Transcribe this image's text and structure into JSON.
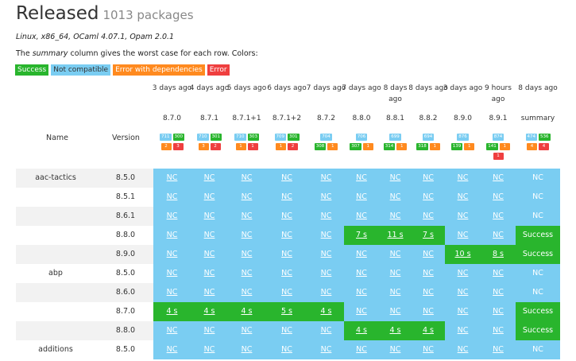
{
  "header": {
    "title": "Released",
    "count": "1013 packages"
  },
  "env": "Linux, x86_64, OCaml 4.07.1, Opam 2.0.1",
  "note": {
    "pre": "The ",
    "em": "summary",
    "post": " column gives the worst case for each row. Colors:"
  },
  "legend": [
    "Success",
    "Not compatible",
    "Error with dependencies",
    "Error"
  ],
  "labels": {
    "name": "Name",
    "version": "Version"
  },
  "columns": [
    {
      "age": "3 days ago",
      "ver": "8.7.0",
      "badges": [
        [
          [
            "nc",
            "711"
          ],
          [
            "s",
            "300"
          ]
        ],
        [
          [
            "ed",
            "2"
          ],
          [
            "e",
            "3"
          ]
        ]
      ]
    },
    {
      "age": "4 days ago",
      "ver": "8.7.1",
      "badges": [
        [
          [
            "nc",
            "710"
          ],
          [
            "s",
            "301"
          ]
        ],
        [
          [
            "ed",
            "3"
          ],
          [
            "e",
            "2"
          ]
        ]
      ]
    },
    {
      "age": "5 days ago",
      "ver": "8.7.1+1",
      "badges": [
        [
          [
            "nc",
            "710"
          ],
          [
            "s",
            "303"
          ]
        ],
        [
          [
            "ed",
            "1"
          ],
          [
            "e",
            "1"
          ]
        ]
      ]
    },
    {
      "age": "6 days ago",
      "ver": "8.7.1+2",
      "badges": [
        [
          [
            "nc",
            "709"
          ],
          [
            "s",
            "301"
          ]
        ],
        [
          [
            "ed",
            "1"
          ],
          [
            "e",
            "2"
          ]
        ]
      ]
    },
    {
      "age": "7 days ago",
      "ver": "8.7.2",
      "badges": [
        [
          [
            "nc",
            "704"
          ]
        ],
        [
          [
            "s",
            "308"
          ],
          [
            "ed",
            "1"
          ]
        ]
      ]
    },
    {
      "age": "7 days ago",
      "ver": "8.8.0",
      "badges": [
        [
          [
            "nc",
            "706"
          ]
        ],
        [
          [
            "s",
            "307"
          ],
          [
            "ed",
            "1"
          ]
        ]
      ]
    },
    {
      "age": "8 days ago",
      "ver": "8.8.1",
      "badges": [
        [
          [
            "nc",
            "699"
          ]
        ],
        [
          [
            "s",
            "314"
          ],
          [
            "ed",
            "1"
          ]
        ]
      ]
    },
    {
      "age": "8 days ago",
      "ver": "8.8.2",
      "badges": [
        [
          [
            "nc",
            "694"
          ]
        ],
        [
          [
            "s",
            "318"
          ],
          [
            "ed",
            "1"
          ]
        ]
      ]
    },
    {
      "age": "3 days ago",
      "ver": "8.9.0",
      "badges": [
        [
          [
            "nc",
            "876"
          ]
        ],
        [
          [
            "s",
            "139"
          ],
          [
            "ed",
            "1"
          ]
        ]
      ]
    },
    {
      "age": "9 hours ago",
      "ver": "8.9.1",
      "badges": [
        [
          [
            "nc",
            "874"
          ]
        ],
        [
          [
            "s",
            "141"
          ],
          [
            "ed",
            "1"
          ]
        ],
        [
          [
            "e",
            "1"
          ]
        ]
      ]
    },
    {
      "age": "8 days ago",
      "ver": "summary",
      "badges": [
        [
          [
            "nc",
            "474"
          ],
          [
            "s",
            "536"
          ]
        ],
        [
          [
            "ed",
            "4"
          ],
          [
            "e",
            "4"
          ]
        ]
      ]
    }
  ],
  "rows": [
    {
      "pkg": "aac-tactics",
      "ver": "8.5.0",
      "cells": [
        [
          "nc",
          "NC"
        ],
        [
          "nc",
          "NC"
        ],
        [
          "nc",
          "NC"
        ],
        [
          "nc",
          "NC"
        ],
        [
          "nc",
          "NC"
        ],
        [
          "nc",
          "NC"
        ],
        [
          "nc",
          "NC"
        ],
        [
          "nc",
          "NC"
        ],
        [
          "nc",
          "NC"
        ],
        [
          "nc",
          "NC"
        ],
        [
          "nc",
          "NC"
        ]
      ]
    },
    {
      "pkg": "",
      "ver": "8.5.1",
      "cells": [
        [
          "nc",
          "NC"
        ],
        [
          "nc",
          "NC"
        ],
        [
          "nc",
          "NC"
        ],
        [
          "nc",
          "NC"
        ],
        [
          "nc",
          "NC"
        ],
        [
          "nc",
          "NC"
        ],
        [
          "nc",
          "NC"
        ],
        [
          "nc",
          "NC"
        ],
        [
          "nc",
          "NC"
        ],
        [
          "nc",
          "NC"
        ],
        [
          "nc",
          "NC"
        ]
      ]
    },
    {
      "pkg": "",
      "ver": "8.6.1",
      "cells": [
        [
          "nc",
          "NC"
        ],
        [
          "nc",
          "NC"
        ],
        [
          "nc",
          "NC"
        ],
        [
          "nc",
          "NC"
        ],
        [
          "nc",
          "NC"
        ],
        [
          "nc",
          "NC"
        ],
        [
          "nc",
          "NC"
        ],
        [
          "nc",
          "NC"
        ],
        [
          "nc",
          "NC"
        ],
        [
          "nc",
          "NC"
        ],
        [
          "nc",
          "NC"
        ]
      ]
    },
    {
      "pkg": "",
      "ver": "8.8.0",
      "cells": [
        [
          "nc",
          "NC"
        ],
        [
          "nc",
          "NC"
        ],
        [
          "nc",
          "NC"
        ],
        [
          "nc",
          "NC"
        ],
        [
          "nc",
          "NC"
        ],
        [
          "s",
          "7 s"
        ],
        [
          "s",
          "11 s"
        ],
        [
          "s",
          "7 s"
        ],
        [
          "nc",
          "NC"
        ],
        [
          "nc",
          "NC"
        ],
        [
          "s",
          "Success"
        ]
      ]
    },
    {
      "pkg": "",
      "ver": "8.9.0",
      "cells": [
        [
          "nc",
          "NC"
        ],
        [
          "nc",
          "NC"
        ],
        [
          "nc",
          "NC"
        ],
        [
          "nc",
          "NC"
        ],
        [
          "nc",
          "NC"
        ],
        [
          "nc",
          "NC"
        ],
        [
          "nc",
          "NC"
        ],
        [
          "nc",
          "NC"
        ],
        [
          "s",
          "10 s"
        ],
        [
          "s",
          "8 s"
        ],
        [
          "s",
          "Success"
        ]
      ]
    },
    {
      "pkg": "abp",
      "ver": "8.5.0",
      "cells": [
        [
          "nc",
          "NC"
        ],
        [
          "nc",
          "NC"
        ],
        [
          "nc",
          "NC"
        ],
        [
          "nc",
          "NC"
        ],
        [
          "nc",
          "NC"
        ],
        [
          "nc",
          "NC"
        ],
        [
          "nc",
          "NC"
        ],
        [
          "nc",
          "NC"
        ],
        [
          "nc",
          "NC"
        ],
        [
          "nc",
          "NC"
        ],
        [
          "nc",
          "NC"
        ]
      ]
    },
    {
      "pkg": "",
      "ver": "8.6.0",
      "cells": [
        [
          "nc",
          "NC"
        ],
        [
          "nc",
          "NC"
        ],
        [
          "nc",
          "NC"
        ],
        [
          "nc",
          "NC"
        ],
        [
          "nc",
          "NC"
        ],
        [
          "nc",
          "NC"
        ],
        [
          "nc",
          "NC"
        ],
        [
          "nc",
          "NC"
        ],
        [
          "nc",
          "NC"
        ],
        [
          "nc",
          "NC"
        ],
        [
          "nc",
          "NC"
        ]
      ]
    },
    {
      "pkg": "",
      "ver": "8.7.0",
      "cells": [
        [
          "s",
          "4 s"
        ],
        [
          "s",
          "4 s"
        ],
        [
          "s",
          "4 s"
        ],
        [
          "s",
          "5 s"
        ],
        [
          "s",
          "4 s"
        ],
        [
          "nc",
          "NC"
        ],
        [
          "nc",
          "NC"
        ],
        [
          "nc",
          "NC"
        ],
        [
          "nc",
          "NC"
        ],
        [
          "nc",
          "NC"
        ],
        [
          "s",
          "Success"
        ]
      ]
    },
    {
      "pkg": "",
      "ver": "8.8.0",
      "cells": [
        [
          "nc",
          "NC"
        ],
        [
          "nc",
          "NC"
        ],
        [
          "nc",
          "NC"
        ],
        [
          "nc",
          "NC"
        ],
        [
          "nc",
          "NC"
        ],
        [
          "s",
          "4 s"
        ],
        [
          "s",
          "4 s"
        ],
        [
          "s",
          "4 s"
        ],
        [
          "nc",
          "NC"
        ],
        [
          "nc",
          "NC"
        ],
        [
          "s",
          "Success"
        ]
      ]
    },
    {
      "pkg": "additions",
      "ver": "8.5.0",
      "cells": [
        [
          "nc",
          "NC"
        ],
        [
          "nc",
          "NC"
        ],
        [
          "nc",
          "NC"
        ],
        [
          "nc",
          "NC"
        ],
        [
          "nc",
          "NC"
        ],
        [
          "nc",
          "NC"
        ],
        [
          "nc",
          "NC"
        ],
        [
          "nc",
          "NC"
        ],
        [
          "nc",
          "NC"
        ],
        [
          "nc",
          "NC"
        ],
        [
          "nc",
          "NC"
        ]
      ]
    }
  ]
}
